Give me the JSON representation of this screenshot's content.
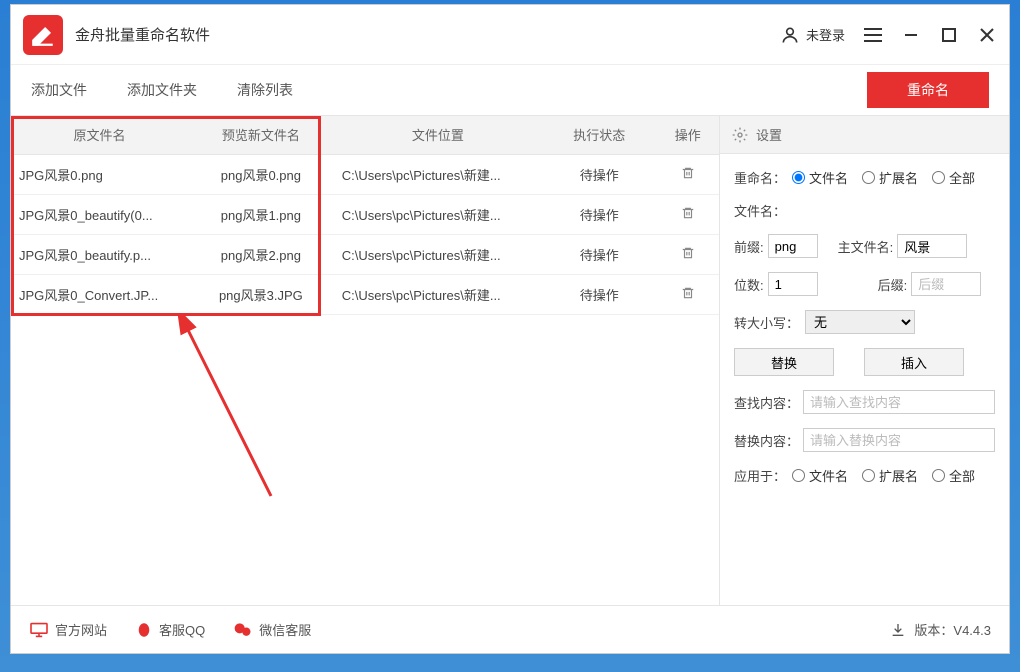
{
  "titlebar": {
    "app_title": "金舟批量重命名软件",
    "login_text": "未登录"
  },
  "toolbar": {
    "add_file": "添加文件",
    "add_folder": "添加文件夹",
    "clear_list": "清除列表",
    "rename": "重命名"
  },
  "table": {
    "headers": {
      "original": "原文件名",
      "preview": "预览新文件名",
      "location": "文件位置",
      "status": "执行状态",
      "action": "操作"
    },
    "rows": [
      {
        "original": "JPG风景0.png",
        "preview": "png风景0.png",
        "location": "C:\\Users\\pc\\Pictures\\新建...",
        "status": "待操作"
      },
      {
        "original": "JPG风景0_beautify(0...",
        "preview": "png风景1.png",
        "location": "C:\\Users\\pc\\Pictures\\新建...",
        "status": "待操作"
      },
      {
        "original": "JPG风景0_beautify.p...",
        "preview": "png风景2.png",
        "location": "C:\\Users\\pc\\Pictures\\新建...",
        "status": "待操作"
      },
      {
        "original": "JPG风景0_Convert.JP...",
        "preview": "png风景3.JPG",
        "location": "C:\\Users\\pc\\Pictures\\新建...",
        "status": "待操作"
      }
    ]
  },
  "settings": {
    "header": "设置",
    "rename_label": "重命名：",
    "rename_options": {
      "filename": "文件名",
      "ext": "扩展名",
      "all": "全部"
    },
    "filename_label": "文件名：",
    "prefix_label": "前缀:",
    "prefix_value": "png",
    "main_label": "主文件名:",
    "main_value": "风景",
    "digits_label": "位数:",
    "digits_value": "1",
    "suffix_label": "后缀:",
    "suffix_placeholder": "后缀",
    "case_label": "转大小写：",
    "case_value": "无",
    "replace_btn": "替换",
    "insert_btn": "插入",
    "find_label": "查找内容：",
    "find_placeholder": "请输入查找内容",
    "replace_label": "替换内容：",
    "replace_placeholder": "请输入替换内容",
    "apply_label": "应用于：",
    "apply_options": {
      "filename": "文件名",
      "ext": "扩展名",
      "all": "全部"
    }
  },
  "footer": {
    "website": "官方网站",
    "qq": "客服QQ",
    "wechat": "微信客服",
    "version": "版本：V4.4.3"
  }
}
